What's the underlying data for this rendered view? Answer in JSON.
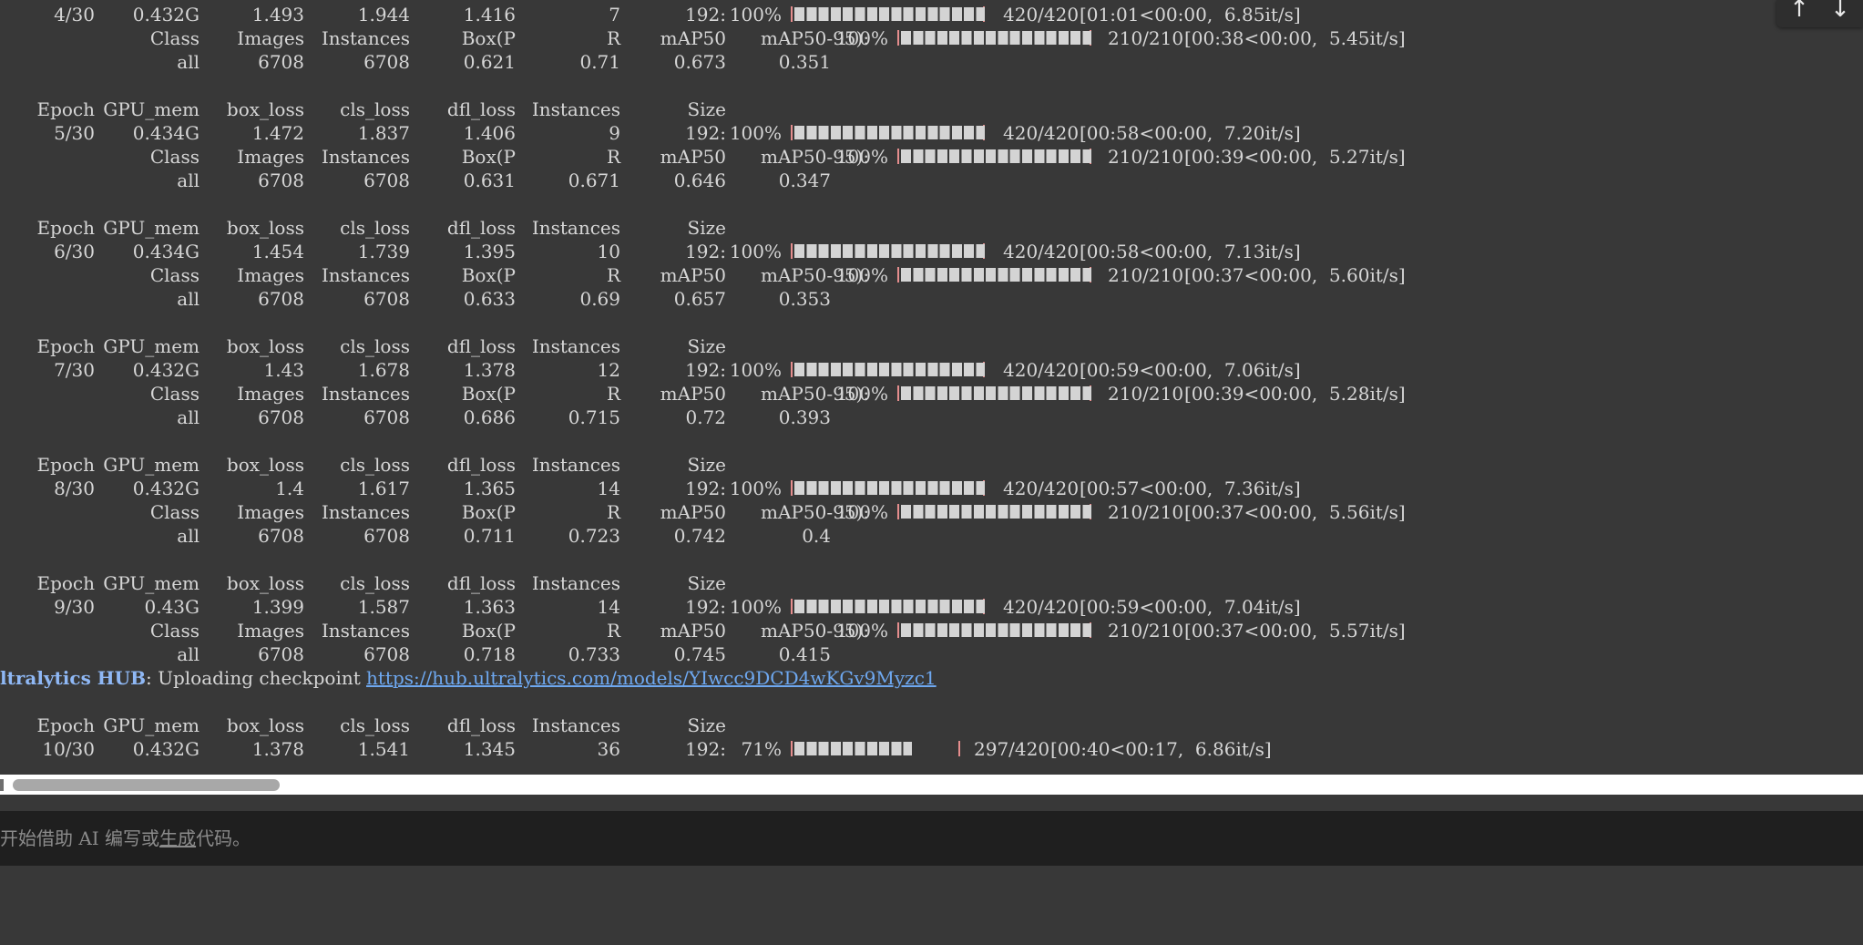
{
  "epoch_header": {
    "epoch": "Epoch",
    "gpu_mem": "GPU_mem",
    "box_loss": "box_loss",
    "cls_loss": "cls_loss",
    "dfl_loss": "dfl_loss",
    "instances": "Instances",
    "size": "Size"
  },
  "val_header": {
    "class": "Class",
    "images": "Images",
    "instances": "Instances",
    "box_p": "Box(P",
    "r": "R",
    "map50": "mAP50",
    "map50_95": "mAP50-95):",
    "pct": "100%"
  },
  "epochs": [
    {
      "epoch": "4/30",
      "gpu_mem": "0.432G",
      "box_loss": "1.493",
      "cls_loss": "1.944",
      "dfl_loss": "1.416",
      "instances": "7",
      "size": "192:",
      "pct": "100%",
      "progress": 1.0,
      "count": "420/420",
      "timing": "[01:01<00:00,  6.85it/s]",
      "val": {
        "class": "all",
        "images": "6708",
        "instances": "6708",
        "box_p": "0.621",
        "r": "0.71",
        "map50": "0.673",
        "map50_95": "0.351",
        "progress": 1.0,
        "count": "210/210",
        "timing": "[00:38<00:00,  5.45it/s]"
      }
    },
    {
      "epoch": "5/30",
      "gpu_mem": "0.434G",
      "box_loss": "1.472",
      "cls_loss": "1.837",
      "dfl_loss": "1.406",
      "instances": "9",
      "size": "192:",
      "pct": "100%",
      "progress": 1.0,
      "count": "420/420",
      "timing": "[00:58<00:00,  7.20it/s]",
      "val": {
        "class": "all",
        "images": "6708",
        "instances": "6708",
        "box_p": "0.631",
        "r": "0.671",
        "map50": "0.646",
        "map50_95": "0.347",
        "progress": 1.0,
        "count": "210/210",
        "timing": "[00:39<00:00,  5.27it/s]"
      }
    },
    {
      "epoch": "6/30",
      "gpu_mem": "0.434G",
      "box_loss": "1.454",
      "cls_loss": "1.739",
      "dfl_loss": "1.395",
      "instances": "10",
      "size": "192:",
      "pct": "100%",
      "progress": 1.0,
      "count": "420/420",
      "timing": "[00:58<00:00,  7.13it/s]",
      "val": {
        "class": "all",
        "images": "6708",
        "instances": "6708",
        "box_p": "0.633",
        "r": "0.69",
        "map50": "0.657",
        "map50_95": "0.353",
        "progress": 1.0,
        "count": "210/210",
        "timing": "[00:37<00:00,  5.60it/s]"
      }
    },
    {
      "epoch": "7/30",
      "gpu_mem": "0.432G",
      "box_loss": "1.43",
      "cls_loss": "1.678",
      "dfl_loss": "1.378",
      "instances": "12",
      "size": "192:",
      "pct": "100%",
      "progress": 1.0,
      "count": "420/420",
      "timing": "[00:59<00:00,  7.06it/s]",
      "val": {
        "class": "all",
        "images": "6708",
        "instances": "6708",
        "box_p": "0.686",
        "r": "0.715",
        "map50": "0.72",
        "map50_95": "0.393",
        "progress": 1.0,
        "count": "210/210",
        "timing": "[00:39<00:00,  5.28it/s]"
      }
    },
    {
      "epoch": "8/30",
      "gpu_mem": "0.432G",
      "box_loss": "1.4",
      "cls_loss": "1.617",
      "dfl_loss": "1.365",
      "instances": "14",
      "size": "192:",
      "pct": "100%",
      "progress": 1.0,
      "count": "420/420",
      "timing": "[00:57<00:00,  7.36it/s]",
      "val": {
        "class": "all",
        "images": "6708",
        "instances": "6708",
        "box_p": "0.711",
        "r": "0.723",
        "map50": "0.742",
        "map50_95": "0.4",
        "progress": 1.0,
        "count": "210/210",
        "timing": "[00:37<00:00,  5.56it/s]"
      }
    },
    {
      "epoch": "9/30",
      "gpu_mem": "0.43G",
      "box_loss": "1.399",
      "cls_loss": "1.587",
      "dfl_loss": "1.363",
      "instances": "14",
      "size": "192:",
      "pct": "100%",
      "progress": 1.0,
      "count": "420/420",
      "timing": "[00:59<00:00,  7.04it/s]",
      "val": {
        "class": "all",
        "images": "6708",
        "instances": "6708",
        "box_p": "0.718",
        "r": "0.733",
        "map50": "0.745",
        "map50_95": "0.415",
        "progress": 1.0,
        "count": "210/210",
        "timing": "[00:37<00:00,  5.57it/s]"
      }
    }
  ],
  "hub": {
    "label": "ltralytics HUB",
    "message": ": Uploading checkpoint ",
    "link": "https://hub.ultralytics.com/models/YIwcc9DCD4wKGv9Myzc1"
  },
  "current_epoch": {
    "epoch": "10/30",
    "gpu_mem": "0.432G",
    "box_loss": "1.378",
    "cls_loss": "1.541",
    "dfl_loss": "1.345",
    "instances": "36",
    "size": "192:",
    "pct": " 71%",
    "progress": 0.707,
    "count": "297/420",
    "timing": "[00:40<00:17,  6.86it/s]"
  },
  "editor": {
    "placeholder_prefix": "开始借助 AI 编写或",
    "generate_link": "生成",
    "placeholder_suffix": "代码。"
  },
  "toolbar": {
    "up_icon": "↑",
    "down_icon": "↓"
  },
  "colors": {
    "output_bg": "#383838",
    "text": "#d6d6d6",
    "bar_border": "#e58d8d",
    "link": "#6ea8f0",
    "editor_bg": "#1f1f1f"
  }
}
